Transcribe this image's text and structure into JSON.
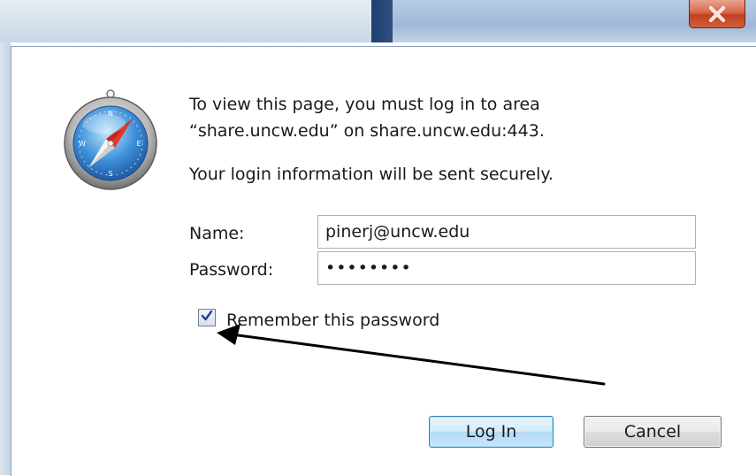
{
  "window": {
    "close_icon": "close-icon"
  },
  "dialog": {
    "app_icon": "safari-compass-icon",
    "message_line1": "To view this page, you must log in to area",
    "message_line2": "“share.uncw.edu” on share.uncw.edu:443.",
    "secure_note": "Your login information will be sent securely.",
    "name_label": "Name:",
    "name_value": "pinerj@uncw.edu",
    "password_label": "Password:",
    "password_masked": "••••••••",
    "remember_label": "Remember this password",
    "remember_checked": true,
    "login_button": "Log In",
    "cancel_button": "Cancel"
  },
  "annotation": {
    "arrow_icon": "pointer-arrow",
    "arrow_color": "#000000"
  },
  "colors": {
    "close_button": "#c7432a",
    "default_button_border": "#3c7fb1",
    "frame": "#c9d7e6"
  }
}
